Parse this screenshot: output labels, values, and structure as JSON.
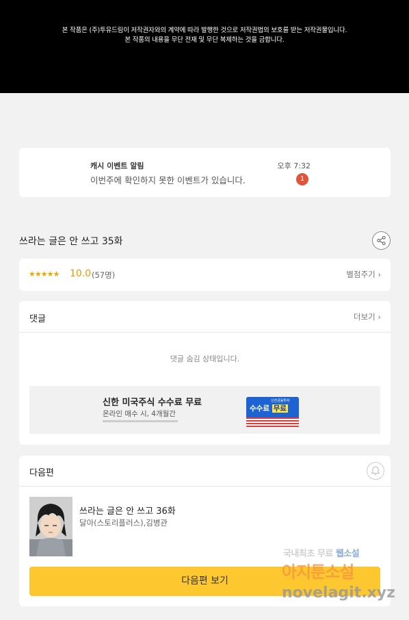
{
  "copyright": {
    "line1": "본 작품은 (주)투유드림이 저작권자와의 계약에 따라 발행한 것으로 저작권법의 보호를 받는 저작권물입니다.",
    "line2": "본 작품의 내용을 무단 전재 및 무단 복제하는 것을 금합니다."
  },
  "notification": {
    "title": "캐시 이벤트 알림",
    "body": "이번주에 확인하지 못한 이벤트가 있습니다.",
    "time": "오후 7:32",
    "badge": "1"
  },
  "episode": {
    "title": "쓰라는 글은 안 쓰고 35화",
    "share_icon": "share-icon"
  },
  "rating": {
    "stars": "★★★★★",
    "score": "10.0",
    "count": "(57명)",
    "rate_label": "별점주기",
    "rate_chevron": "›"
  },
  "comments": {
    "label": "댓글",
    "more_label": "더보기",
    "more_chevron": "›",
    "hidden_message": "댓글 숨김 상태입니다."
  },
  "ad": {
    "title": "신한 미국주식 수수료 무료",
    "subtitle": "온라인 매수 시, 4개월간",
    "banner_brand": "신한금융투자",
    "banner_text_plain": "수수료",
    "banner_text_highlight": "무료"
  },
  "next": {
    "label": "다음편",
    "bell_icon": "bell-icon",
    "episode_title": "쓰라는 글은 안 쓰고 36화",
    "authors": "달아(스토리플러스),김병관",
    "button_label": "다음편 보기"
  },
  "watermark": {
    "line1_a": "국내최초 무료",
    "line1_b": "웹소설",
    "line2": "아지툰소설",
    "line3": "novelagit.xyz"
  },
  "colors": {
    "accent_yellow": "#fdc82f",
    "star_orange": "#f0a500",
    "badge_red": "#e0553a"
  }
}
